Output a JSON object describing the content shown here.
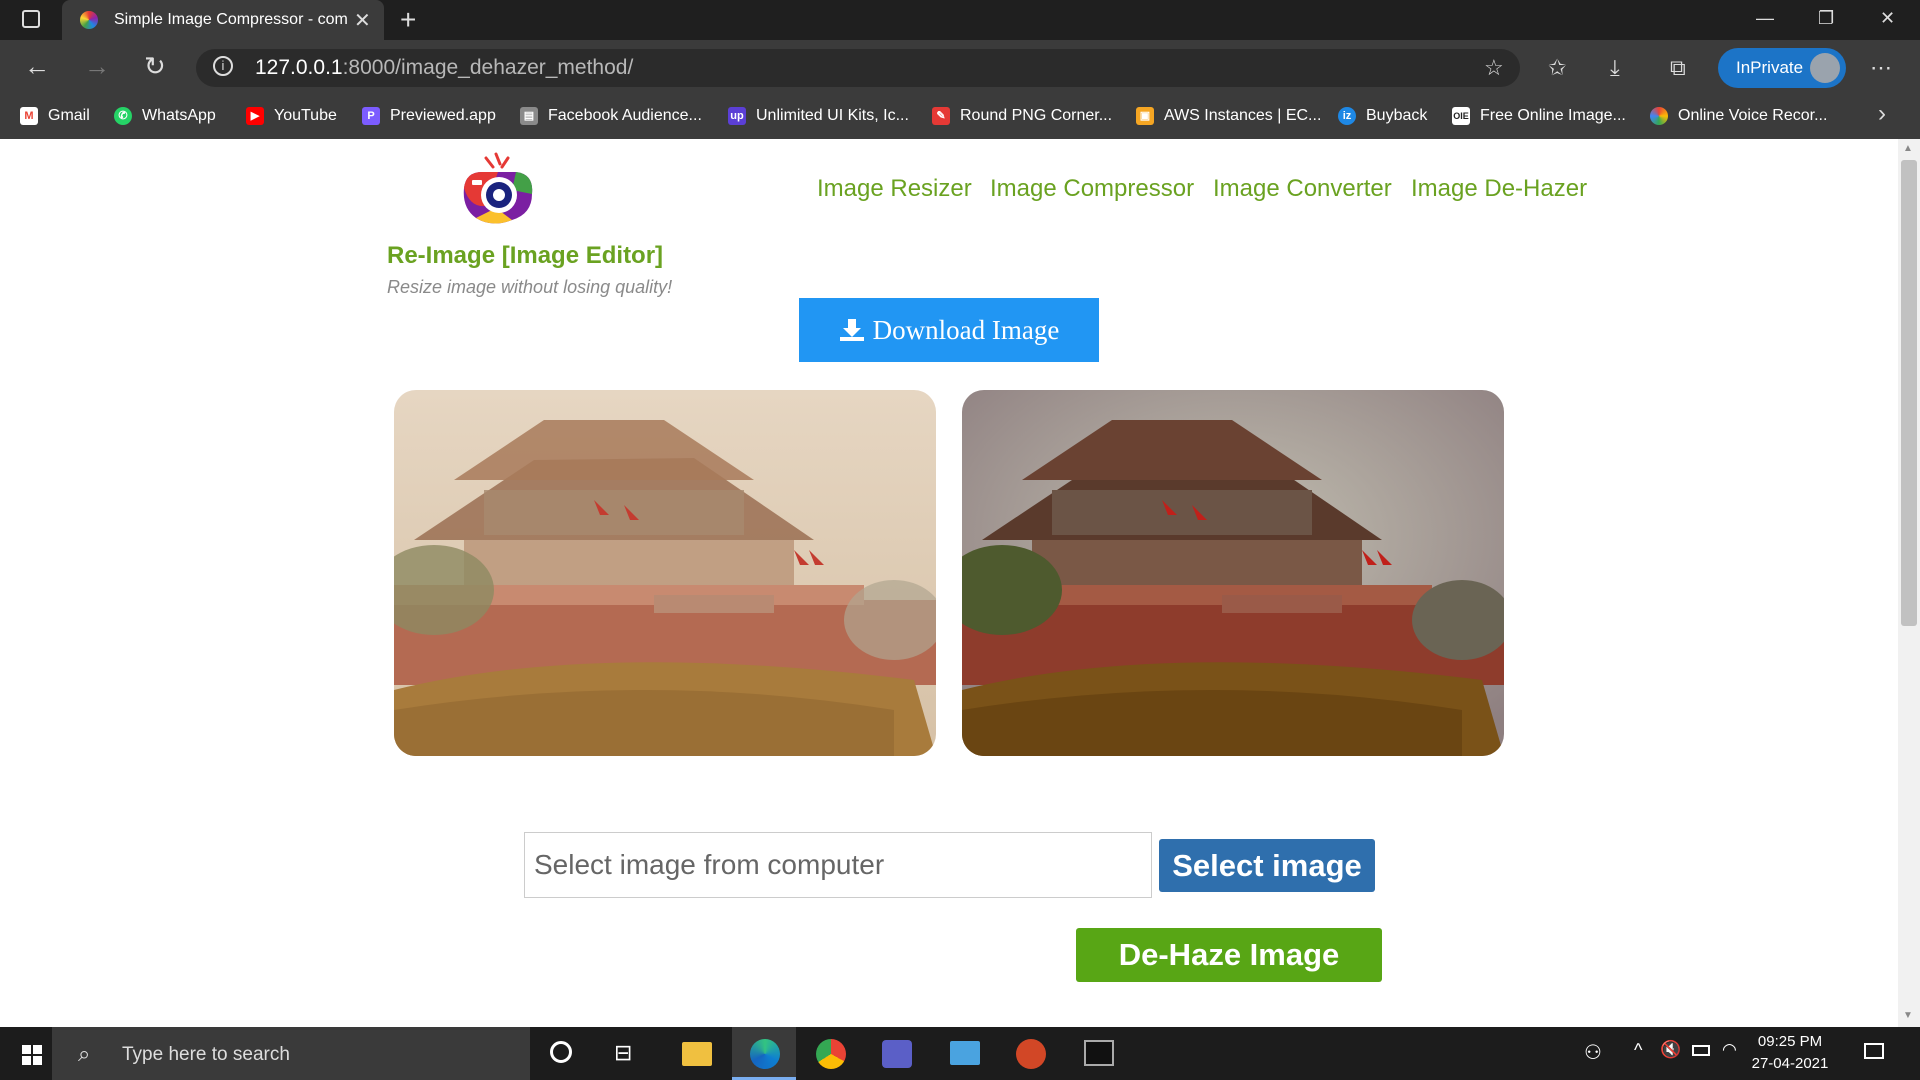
{
  "browser": {
    "tab_title": "Simple Image Compressor - com",
    "url_host": "127.0.0.1",
    "url_rest": ":8000/image_dehazer_method/",
    "inprivate_label": "InPrivate",
    "bookmarks": [
      {
        "label": "Gmail",
        "icon": "gmail-icon",
        "color": "#ea4335"
      },
      {
        "label": "WhatsApp",
        "icon": "whatsapp-icon",
        "color": "#25d366"
      },
      {
        "label": "YouTube",
        "icon": "youtube-icon",
        "color": "#ff0000"
      },
      {
        "label": "Previewed.app",
        "icon": "previewed-icon",
        "color": "#7c5cff"
      },
      {
        "label": "Facebook Audience...",
        "icon": "facebook-audience-icon",
        "color": "#8a8a8a"
      },
      {
        "label": "Unlimited UI Kits, Ic...",
        "icon": "upwork-icon",
        "color": "#5b3fd6"
      },
      {
        "label": "Round PNG Corner...",
        "icon": "round-png-icon",
        "color": "#e53935"
      },
      {
        "label": "AWS Instances | EC...",
        "icon": "aws-icon",
        "color": "#f5a623"
      },
      {
        "label": "Buyback",
        "icon": "buyback-icon",
        "color": "#1e88e5"
      },
      {
        "label": "Free Online Image...",
        "icon": "oie-icon",
        "color": "#ffffff"
      },
      {
        "label": "Online Voice Recor...",
        "icon": "voice-recorder-icon",
        "color": "#fbbc05"
      }
    ]
  },
  "site": {
    "brand": "Re-Image [Image Editor]",
    "tagline": "Resize image without losing quality!",
    "nav": [
      "Image Resizer",
      "Image Compressor",
      "Image Converter",
      "Image De-Hazer"
    ],
    "download_label": "Download Image",
    "file_placeholder": "Select image from computer",
    "select_label": "Select image",
    "dehaze_label": "De-Haze Image",
    "accent_color": "#6aa221"
  },
  "taskbar": {
    "search_placeholder": "Type here to search",
    "time": "09:25 PM",
    "date": "27-04-2021"
  }
}
